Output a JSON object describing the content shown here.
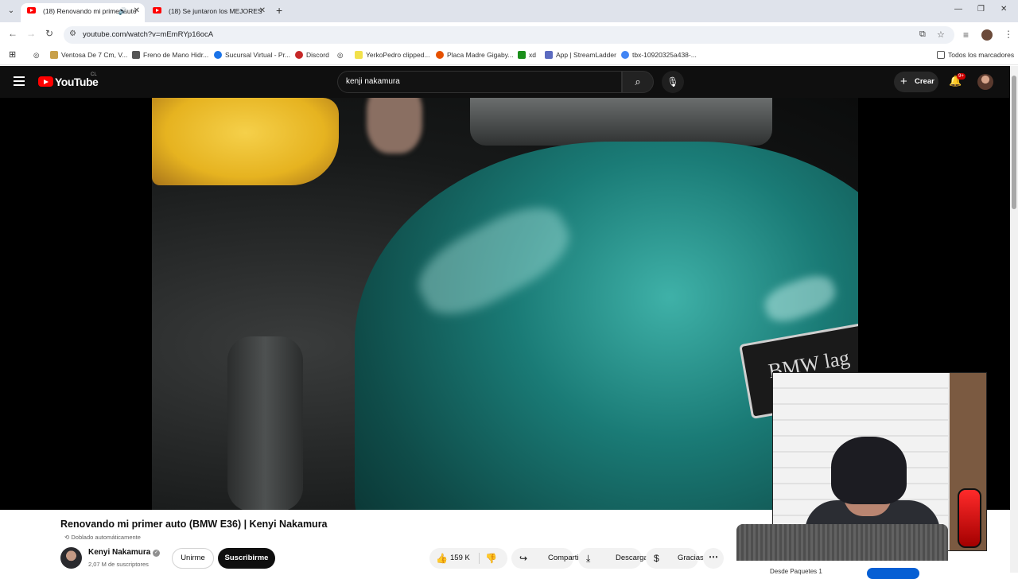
{
  "browser": {
    "tabs": [
      {
        "label": "(18) Renovando mi primer auto",
        "active": true
      },
      {
        "label": "(18) Se juntaron los MEJORES",
        "active": false
      }
    ],
    "url": "youtube.com/watch?v=mEmRYp16ocA",
    "bookmarks": [
      {
        "label": "Ventosa De 7 Cm, V...",
        "color": "#c8a04a"
      },
      {
        "label": "Freno de Mano Hidr...",
        "color": "#555555"
      },
      {
        "label": "Sucursal Virtual - Pr...",
        "color": "#1a73e8"
      },
      {
        "label": "Discord",
        "color": "#c62828"
      },
      {
        "label": "YerkoPedro clipped...",
        "color": "#f2e14b"
      },
      {
        "label": "Placa Madre Gigaby...",
        "color": "#e65100"
      },
      {
        "label": "xd",
        "color": "#1b1b1b"
      },
      {
        "label": "App | StreamLadder",
        "color": "#5c6bc0"
      },
      {
        "label": "tbx-10920325a438-...",
        "color": "#4285f4"
      }
    ],
    "all_bookmarks": "Todos los marcadores"
  },
  "youtube": {
    "logo_text": "YouTube",
    "region": "CL",
    "search_query": "kenji nakamura",
    "create_label": "Crear",
    "notifications": "9+"
  },
  "video": {
    "label_text": "BMW lag",
    "title": "Renovando mi primer auto (BMW E36) | Kenyi Nakamura",
    "dub_label": "Doblado automáticamente",
    "channel": "Kenyi Nakamura",
    "subscribers": "2,07 M de suscriptores",
    "join_label": "Unirme",
    "subscribe_label": "Suscribirme",
    "likes": "159 K",
    "share_label": "Compartir",
    "download_label": "Descargar",
    "thanks_label": "Gracias"
  },
  "ad": {
    "text": "Desde Paquetes 1"
  }
}
